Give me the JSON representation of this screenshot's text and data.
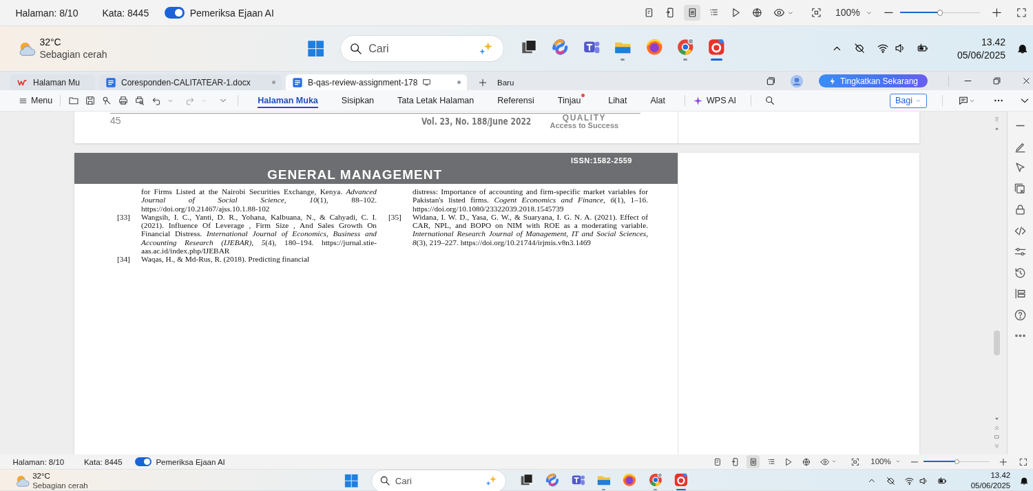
{
  "status_bar_top": {
    "page": "Halaman: 8/10",
    "words": "Kata: 8445",
    "spellcheck": {
      "label": "Pemeriksa Ejaan AI",
      "on": true
    },
    "views": [
      {
        "kind": "reading",
        "selected": false
      },
      {
        "kind": "mobile",
        "selected": false
      },
      {
        "kind": "page",
        "selected": true
      },
      {
        "kind": "outline",
        "selected": false
      },
      {
        "kind": "play",
        "selected": false
      },
      {
        "kind": "web",
        "selected": false
      }
    ],
    "zoom": "100%",
    "zoom_slider": {
      "level": 0.5
    }
  },
  "taskbar_top": {
    "weather": {
      "temperature": "32°C",
      "condition": "Sebagian cerah"
    },
    "search": {
      "placeholder": "Cari"
    },
    "apps": [
      {
        "kind": "stack",
        "running": false,
        "active": false
      },
      {
        "kind": "swirl",
        "running": false,
        "active": false
      },
      {
        "kind": "team",
        "running": false,
        "active": false
      },
      {
        "kind": "folder",
        "running": true,
        "active": false
      },
      {
        "kind": "fox",
        "running": false,
        "active": false
      },
      {
        "kind": "browser",
        "running": true,
        "active": false
      },
      {
        "kind": "office",
        "running": true,
        "active": true
      }
    ],
    "clock": {
      "time": "13.42",
      "date": "05/06/2025"
    }
  },
  "tabs": [
    {
      "kind": "home",
      "label": "Halaman Mu",
      "selected": false
    },
    {
      "kind": "doc",
      "label": "Coresponden-CALITATEAR-1.docx",
      "selected": false
    },
    {
      "kind": "doc",
      "label": "B-qas-review-assignment-178",
      "selected": true
    }
  ],
  "new_tab": "Baru",
  "upgrade_button": "Tingkatkan Sekarang",
  "menu": "Menu",
  "ribbon_tabs": [
    {
      "label": "Halaman Muka",
      "selected": true,
      "badge": false
    },
    {
      "label": "Sisipkan",
      "selected": false,
      "badge": false
    },
    {
      "label": "Tata Letak Halaman",
      "selected": false,
      "badge": false
    },
    {
      "label": "Referensi",
      "selected": false,
      "badge": false
    },
    {
      "label": "Tinjau",
      "selected": false,
      "badge": true
    },
    {
      "label": "Lihat",
      "selected": false,
      "badge": false
    },
    {
      "label": "Alat",
      "selected": false,
      "badge": false
    }
  ],
  "ai_button": "WPS AI",
  "share_button": "Bagi",
  "document": {
    "previous_page": {
      "page_number": "45",
      "issue": "Vol. 23, No. 188/June  2022",
      "logo_title": "QUALITY",
      "logo_subtitle": "Access to Success"
    },
    "page": {
      "issn": "ISSN:1582-2559",
      "section": "GENERAL MANAGEMENT",
      "columns": [
        [
          {
            "text": "for Firms Listed at the Nairobi Securities Exchange, Kenya. *Advanced Journal of Social Science*, *10*(1), 88–102. https://doi.org/10.21467/ajss.10.1.88-102"
          },
          {
            "number": "[33]",
            "text": "Wangsih, I. C., Yanti, D. R., Yohana, Kalbuana, N., & Cahyadi, C. I. (2021). Influence Of Leverage , Firm Size , And Sales Growth On Financial Distress. *International Journal of Economics, Business and Accounting Research (IJEBAR)*, *5*(4), 180–194. https://jurnal.stie-aas.ac.id/index.php/IJEBAR"
          },
          {
            "number": "[34]",
            "text": "Waqas, H., & Md-Rus, R. (2018). Predicting financial"
          }
        ],
        [
          {
            "text": "distress: Importance of accounting and firm-specific market variables for Pakistan's listed firms. *Cogent Economics and Finance*, *6*(1), 1–16. https://doi.org/10.1080/23322039.2018.1545739"
          },
          {
            "number": "[35]",
            "text": "Widana, I. W. D., Yasa, G. W., & Suaryana, I. G. N. A. (2021). Effect of CAR, NPL, and BOPO on NIM with ROE as a moderating variable. *International Research Journal of Management, IT and Social Sciences*, *8*(3), 219–227. https://doi.org/10.21744/irjmis.v8n3.1469"
          }
        ]
      ]
    }
  },
  "status_bar_bottom": {
    "page": "Halaman: 8/10",
    "words": "Kata: 8445",
    "spellcheck": {
      "label": "Pemeriksa Ejaan AI",
      "on": true
    },
    "views": [
      {
        "kind": "reading",
        "selected": false
      },
      {
        "kind": "mobile",
        "selected": false
      },
      {
        "kind": "page",
        "selected": true
      },
      {
        "kind": "outline",
        "selected": false
      },
      {
        "kind": "play",
        "selected": false
      },
      {
        "kind": "web",
        "selected": false
      }
    ],
    "zoom": "100%",
    "zoom_slider": {
      "level": 0.5
    }
  },
  "taskbar_bottom": {
    "weather": {
      "temperature": "32°C",
      "condition": "Sebagian cerah"
    },
    "search": {
      "placeholder": "Cari"
    },
    "apps": [
      {
        "kind": "stack",
        "running": false,
        "active": false
      },
      {
        "kind": "swirl",
        "running": false,
        "active": false
      },
      {
        "kind": "team",
        "running": false,
        "active": false
      },
      {
        "kind": "folder",
        "running": true,
        "active": false
      },
      {
        "kind": "fox",
        "running": false,
        "active": false
      },
      {
        "kind": "browser",
        "running": true,
        "active": false
      },
      {
        "kind": "office",
        "running": true,
        "active": true
      }
    ],
    "clock": {
      "time": "13.42",
      "date": "05/06/2025"
    }
  }
}
